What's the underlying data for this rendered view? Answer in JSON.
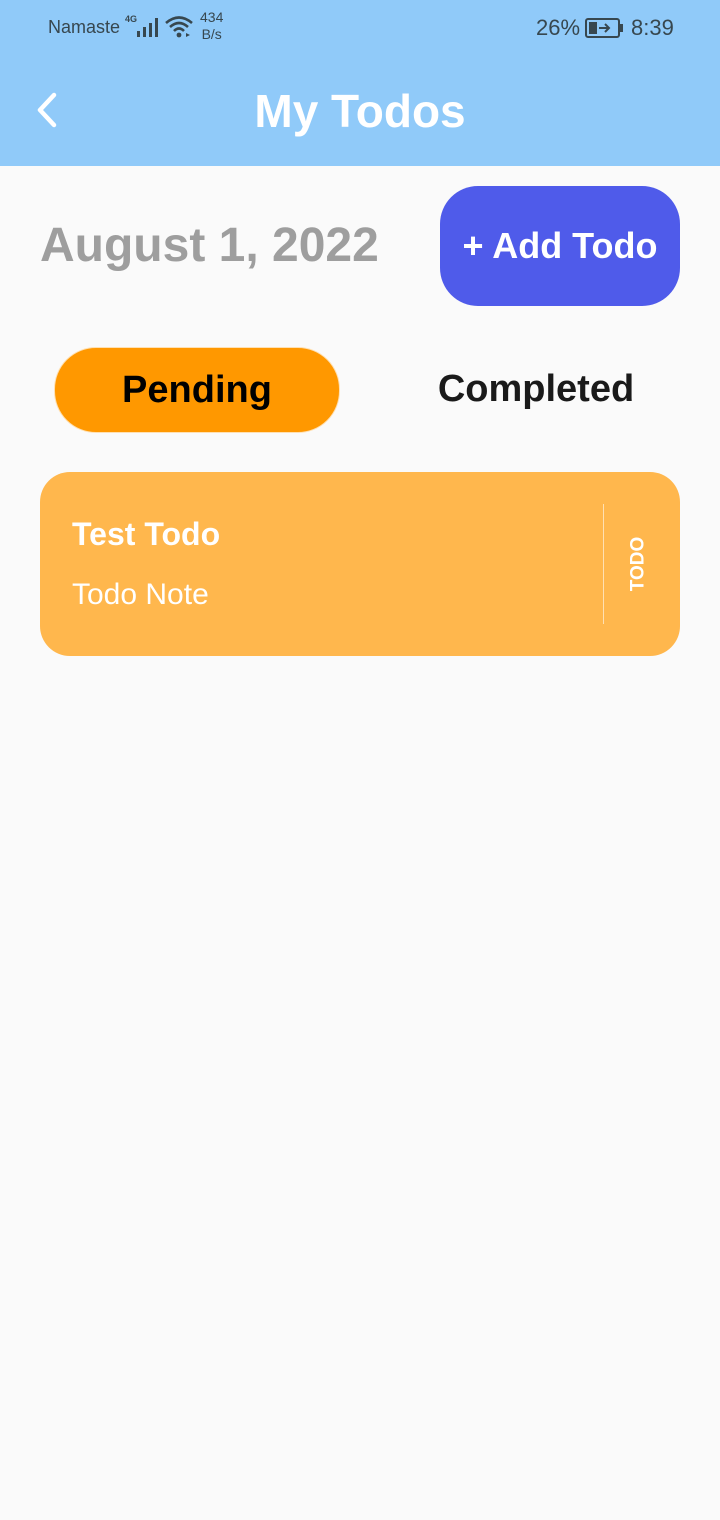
{
  "status_bar": {
    "carrier": "Namaste",
    "network": "4G",
    "speed_value": "434",
    "speed_unit": "B/s",
    "battery": "26%",
    "time": "8:39"
  },
  "app_bar": {
    "title": "My Todos",
    "back_icon": "chevron-left-icon",
    "color": "#90caf9"
  },
  "header": {
    "date": "August 1, 2022",
    "add_button_label": "+ Add Todo",
    "add_button_color": "#4f5bea"
  },
  "tabs": [
    {
      "label": "Pending",
      "selected": true,
      "color": "#ff9800"
    },
    {
      "label": "Completed",
      "selected": false
    }
  ],
  "todos": [
    {
      "title": "Test Todo",
      "note": "Todo Note",
      "status": "TODO",
      "color": "#ffb74d"
    }
  ]
}
